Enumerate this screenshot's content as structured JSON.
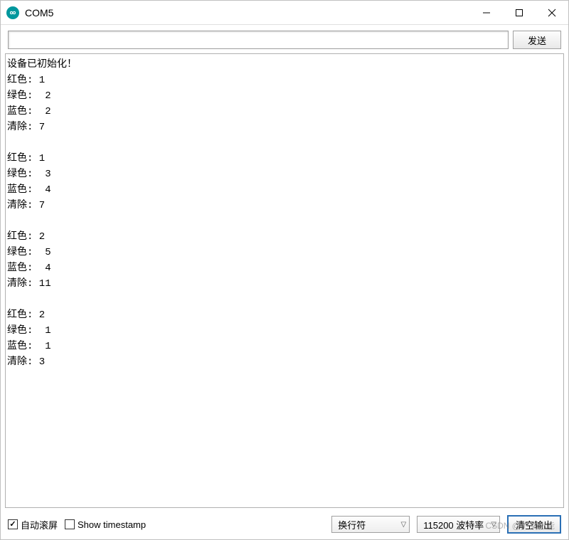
{
  "window": {
    "title": "COM5"
  },
  "toolbar": {
    "send_label": "发送",
    "input_value": ""
  },
  "output": {
    "lines": [
      "设备已初始化！",
      "红色: 1",
      "绿色:  2",
      "蓝色:  2",
      "清除: 7",
      "",
      "红色: 1",
      "绿色:  3",
      "蓝色:  4",
      "清除: 7",
      "",
      "红色: 2",
      "绿色:  5",
      "蓝色:  4",
      "清除: 11",
      "",
      "红色: 2",
      "绿色:  1",
      "蓝色:  1",
      "清除: 3"
    ]
  },
  "bottom": {
    "autoscroll_label": "自动滚屏",
    "autoscroll_checked": true,
    "timestamp_label": "Show timestamp",
    "timestamp_checked": false,
    "lineending_value": "换行符",
    "baud_value": "115200 波特率",
    "clear_label": "清空输出"
  },
  "watermark": "CSDN @扩文化能"
}
